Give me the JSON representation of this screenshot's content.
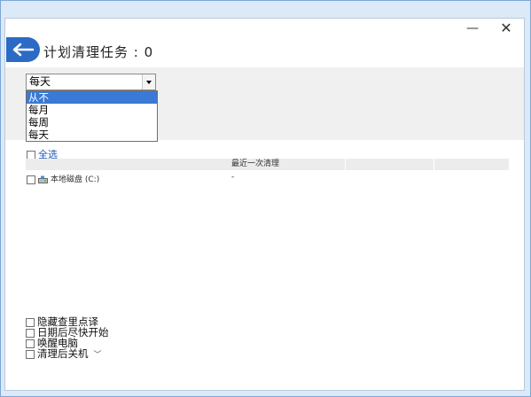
{
  "window": {
    "minimize_label": "—",
    "close_label": "✕"
  },
  "header": {
    "title": "计划清理任务 : 0",
    "back_icon": "arrow-left-icon",
    "back_color": "#2c6bc5"
  },
  "schedule": {
    "selected": "每天",
    "options": [
      "从不",
      "每月",
      "每周",
      "每天"
    ],
    "highlighted_index": 0
  },
  "select_all_label": "全选",
  "table": {
    "column_last_cleanup": "最近一次清理",
    "rows": [
      {
        "name": "本地磁盘 (C:)",
        "last_cleanup": "-",
        "icon": "drive-icon"
      }
    ]
  },
  "options": [
    {
      "label": "隐藏查里点译"
    },
    {
      "label": "日期后尽快开始"
    },
    {
      "label": "唤醒电脑"
    },
    {
      "label": "清理后关机"
    }
  ]
}
